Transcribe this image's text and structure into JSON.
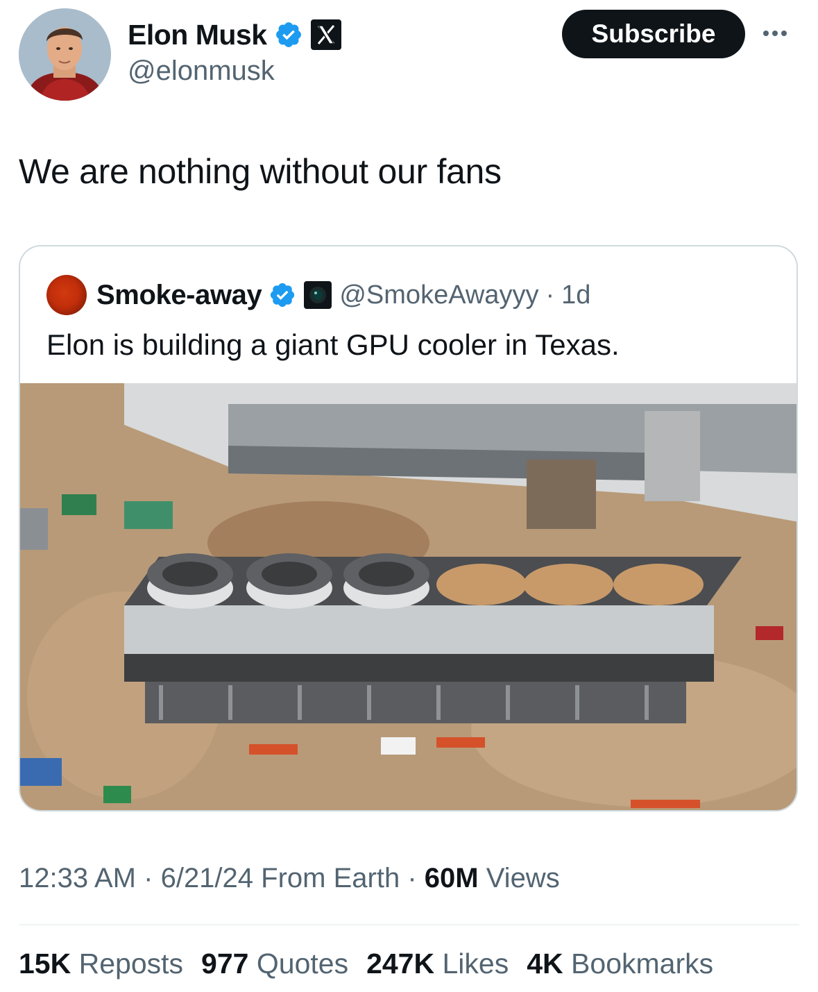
{
  "author": {
    "name": "Elon Musk",
    "handle": "@elonmusk",
    "verified_color": "#1d9bf0"
  },
  "actions": {
    "subscribe_label": "Subscribe",
    "more_icon": "more-horizontal-icon"
  },
  "tweet": {
    "text": "We are nothing without our fans"
  },
  "quote": {
    "name": "Smoke-away",
    "handle": "@SmokeAwayyy",
    "time": "1d",
    "text": "Elon is building a giant GPU cooler in Texas.",
    "image_alt": "Aerial view of a data-center construction site with a large rooftop cooler with three fans"
  },
  "meta": {
    "time": "12:33 AM",
    "date": "6/21/24",
    "source": "From Earth",
    "views_count": "60M",
    "views_label": "Views"
  },
  "stats": [
    {
      "count": "15K",
      "label": "Reposts"
    },
    {
      "count": "977",
      "label": "Quotes"
    },
    {
      "count": "247K",
      "label": "Likes"
    },
    {
      "count": "4K",
      "label": "Bookmarks"
    }
  ]
}
